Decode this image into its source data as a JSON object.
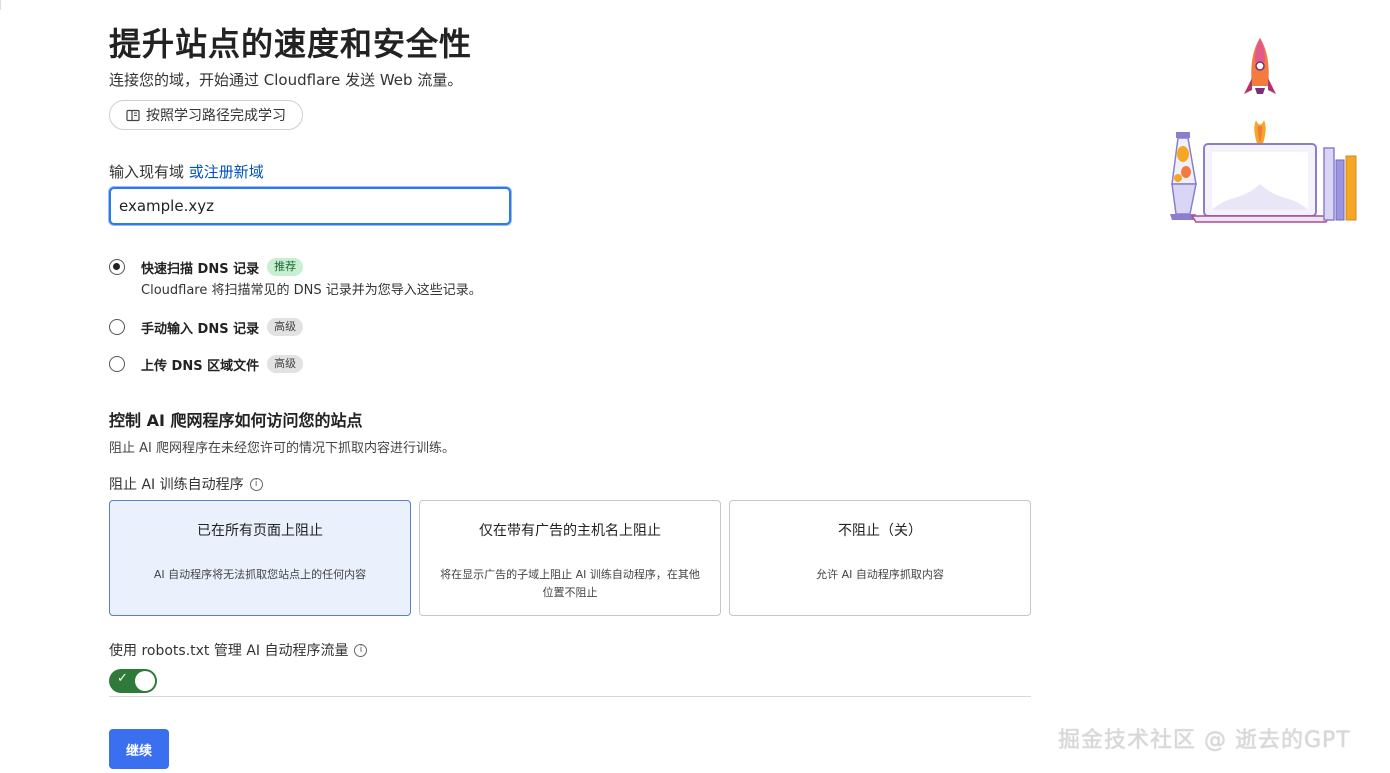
{
  "header": {
    "title": "提升站点的速度和安全性",
    "subtitle": "连接您的域，开始通过 Cloudflare 发送 Web 流量。",
    "learn_button_label": "按照学习路径完成学习"
  },
  "domain": {
    "label": "输入现有域",
    "register_link": "或注册新域",
    "value": "example.xyz"
  },
  "dns_options": [
    {
      "title": "快速扫描 DNS 记录",
      "badge": "推荐",
      "description": "Cloudflare 将扫描常见的 DNS 记录并为您导入这些记录。",
      "checked": true
    },
    {
      "title": "手动输入 DNS 记录",
      "badge": "高级",
      "checked": false
    },
    {
      "title": "上传 DNS 区域文件",
      "badge": "高级",
      "checked": false
    }
  ],
  "ai": {
    "title": "控制 AI 爬网程序如何访问您的站点",
    "description": "阻止 AI 爬网程序在未经您许可的情况下抓取内容进行训练。",
    "block_label": "阻止 AI 训练自动程序",
    "info_glyph": "i",
    "options": [
      {
        "title": "已在所有页面上阻止",
        "description": "AI 自动程序将无法抓取您站点上的任何内容",
        "selected": true
      },
      {
        "title": "仅在带有广告的主机名上阻止",
        "description": "将在显示广告的子域上阻止 AI 训练自动程序，在其他位置不阻止",
        "selected": false
      },
      {
        "title": "不阻止（关）",
        "description": "允许 AI 自动程序抓取内容",
        "selected": false
      }
    ],
    "robots_label": "使用 robots.txt 管理 AI 自动程序流量",
    "robots_enabled": true,
    "toggle_check": "✓"
  },
  "footer": {
    "continue_label": "继续"
  },
  "watermark": "掘金技术社区 @ 逝去的GPT",
  "colors": {
    "primary_button": "#3a6ff0",
    "link": "#0051c3",
    "toggle_on": "#2f7a3b",
    "selected_card_bg": "#eaf1fd"
  }
}
